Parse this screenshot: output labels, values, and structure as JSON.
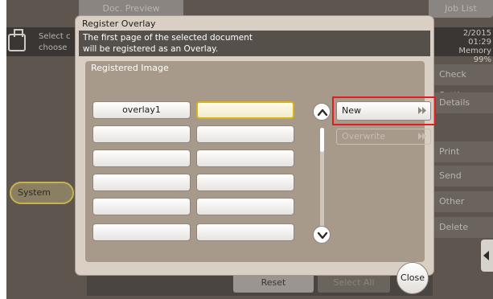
{
  "background": {
    "tab_doc_preview": "Doc. Preview",
    "tab_job_list": "Job List",
    "header_line1": "Select c",
    "header_line2": "choose",
    "stats_date": "2/2015",
    "stats_time": "01:29",
    "stats_memory_label": "Memory",
    "stats_memory_value": "99%",
    "side_buttons": [
      "Check Setting",
      "Details",
      "Print",
      "Send",
      "Other",
      "Delete"
    ],
    "system_button": "System",
    "reset_button": "Reset",
    "select_all_button": "Select All"
  },
  "dialog": {
    "title": "Register Overlay",
    "message_line1": "The first page of the selected document",
    "message_line2": "will be registered as an Overlay.",
    "panel_label": "Registered Image",
    "slots_left": [
      "overlay1",
      "",
      "",
      "",
      "",
      ""
    ],
    "slots_right": [
      "",
      "",
      "",
      "",
      "",
      ""
    ],
    "selected_slot": "right-0",
    "new_label": "New",
    "overwrite_label": "Overwrite",
    "close_label": "Close"
  },
  "colors": {
    "highlight": "#e02020",
    "selected_border": "#d8b31a",
    "message_bg": "#55504a"
  },
  "icons": [
    "scroll-up-icon",
    "scroll-down-icon",
    "fast-forward-icon",
    "document-icon",
    "left-arrow-icon"
  ]
}
